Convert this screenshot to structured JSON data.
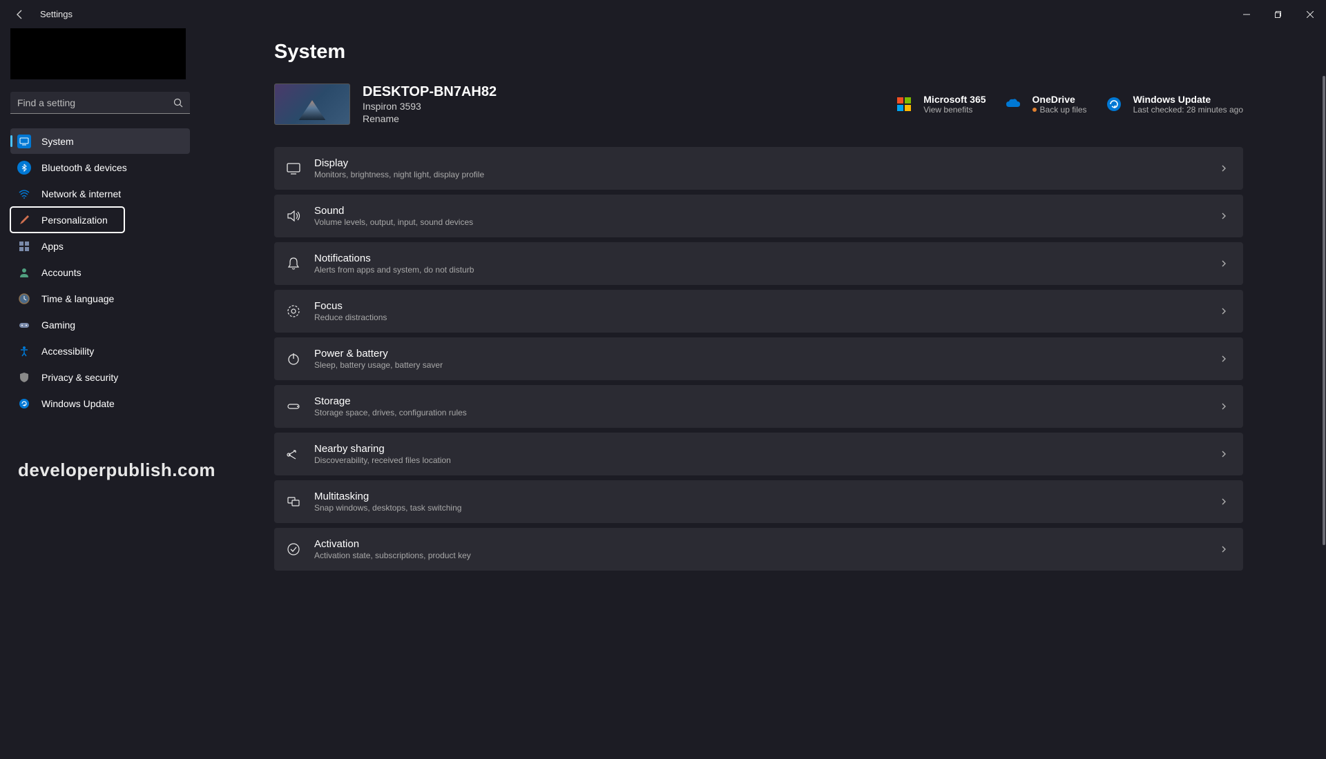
{
  "titlebar": {
    "app_title": "Settings"
  },
  "search": {
    "placeholder": "Find a setting"
  },
  "sidebar": {
    "items": [
      {
        "label": "System",
        "icon": "system",
        "color": "#0078d4"
      },
      {
        "label": "Bluetooth & devices",
        "icon": "bluetooth",
        "color": "#0078d4"
      },
      {
        "label": "Network & internet",
        "icon": "wifi",
        "color": "#0078d4"
      },
      {
        "label": "Personalization",
        "icon": "brush",
        "color": "#d07050"
      },
      {
        "label": "Apps",
        "icon": "apps",
        "color": "#7a8aaa"
      },
      {
        "label": "Accounts",
        "icon": "person",
        "color": "#50a080"
      },
      {
        "label": "Time & language",
        "icon": "clock",
        "color": "#8a7050"
      },
      {
        "label": "Gaming",
        "icon": "gamepad",
        "color": "#7a8aaa"
      },
      {
        "label": "Accessibility",
        "icon": "accessibility",
        "color": "#0078d4"
      },
      {
        "label": "Privacy & security",
        "icon": "shield",
        "color": "#8a8a8a"
      },
      {
        "label": "Windows Update",
        "icon": "update",
        "color": "#0078d4"
      }
    ]
  },
  "watermark": "developerpublish.com",
  "page": {
    "title": "System"
  },
  "device": {
    "name": "DESKTOP-BN7AH82",
    "model": "Inspiron 3593",
    "rename_label": "Rename"
  },
  "header_cards": [
    {
      "title": "Microsoft 365",
      "sub": "View benefits"
    },
    {
      "title": "OneDrive",
      "sub": "Back up files"
    },
    {
      "title": "Windows Update",
      "sub": "Last checked: 28 minutes ago"
    }
  ],
  "settings": [
    {
      "icon": "display",
      "title": "Display",
      "sub": "Monitors, brightness, night light, display profile"
    },
    {
      "icon": "sound",
      "title": "Sound",
      "sub": "Volume levels, output, input, sound devices"
    },
    {
      "icon": "notifications",
      "title": "Notifications",
      "sub": "Alerts from apps and system, do not disturb"
    },
    {
      "icon": "focus",
      "title": "Focus",
      "sub": "Reduce distractions"
    },
    {
      "icon": "power",
      "title": "Power & battery",
      "sub": "Sleep, battery usage, battery saver"
    },
    {
      "icon": "storage",
      "title": "Storage",
      "sub": "Storage space, drives, configuration rules"
    },
    {
      "icon": "nearby",
      "title": "Nearby sharing",
      "sub": "Discoverability, received files location"
    },
    {
      "icon": "multitask",
      "title": "Multitasking",
      "sub": "Snap windows, desktops, task switching"
    },
    {
      "icon": "activation",
      "title": "Activation",
      "sub": "Activation state, subscriptions, product key"
    }
  ]
}
